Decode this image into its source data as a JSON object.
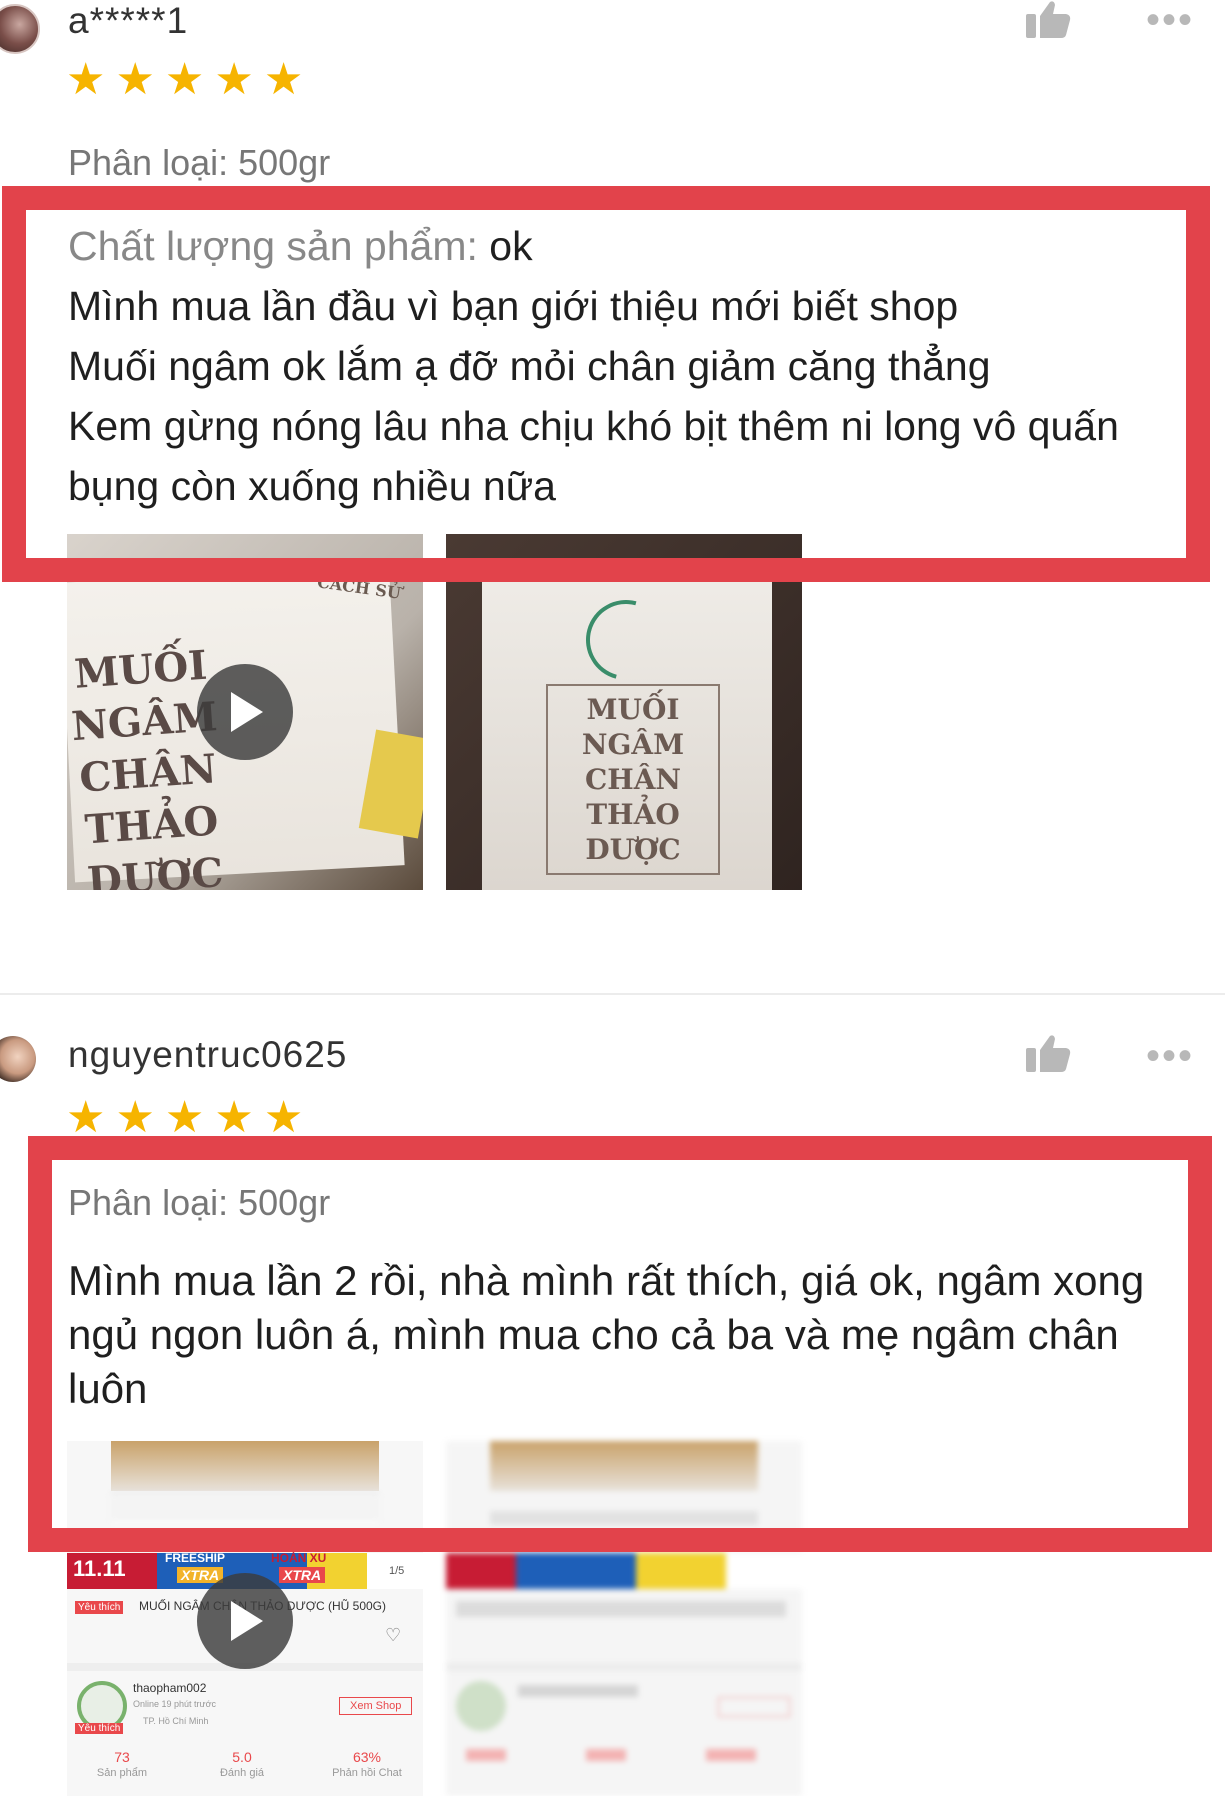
{
  "reviews": [
    {
      "username": "a*****1",
      "rating": 5,
      "variant": "Phân loại: 500gr",
      "quality_label": "Chất lượng sản phẩm:",
      "quality_value": "ok",
      "lines": [
        "Mình mua lần đầu vì bạn giới thiệu mới biết shop",
        "Muối ngâm ok lắm ạ đỡ mỏi chân giảm căng thẳng",
        "Kem gừng nóng lâu nha chịu khó bịt thêm ni long vô quấn",
        "bụng còn xuống nhiều nữa"
      ],
      "media": [
        {
          "type": "video",
          "jar_text": [
            "MUỐI",
            "NGÂM",
            "CHÂN",
            "THẢO",
            "DƯỢC"
          ],
          "side_text": "CÁCH SỬ"
        },
        {
          "type": "image",
          "jar_text": [
            "MUỐI",
            "NGÂM",
            "CHÂN",
            "THẢO",
            "DƯỢC"
          ]
        }
      ]
    },
    {
      "username": "nguyentruc0625",
      "rating": 5,
      "variant": "Phân loại: 500gr",
      "text": "Mình mua lần 2 rồi, nhà mình rất thích, giá ok, ngâm xong ngủ ngon luôn á, mình mua cho cả ba và mẹ ngâm chân luôn",
      "media_screenshot": {
        "badge": "11.11",
        "freeship": "FREESHIP",
        "xtra": "XTRA",
        "hoan_xu": "HOÀN XU",
        "counter": "1/5",
        "fav_tag": "Yêu thích",
        "product_name": "MUỐI NGÂM CHÂN THẢO DƯỢC (HŨ 500G)",
        "shop_name": "thaopham002",
        "online": "Online 19 phút trước",
        "location": "TP. Hồ Chí Minh",
        "view_shop": "Xem Shop",
        "stats": [
          {
            "value": "73",
            "label": "Sản phẩm"
          },
          {
            "value": "5.0",
            "label": "Đánh giá"
          },
          {
            "value": "63%",
            "label": "Phản hồi Chat"
          }
        ]
      }
    }
  ],
  "colors": {
    "highlight": "#e2434b",
    "star": "#f6b400",
    "icon_gray": "#b8b8b8"
  }
}
